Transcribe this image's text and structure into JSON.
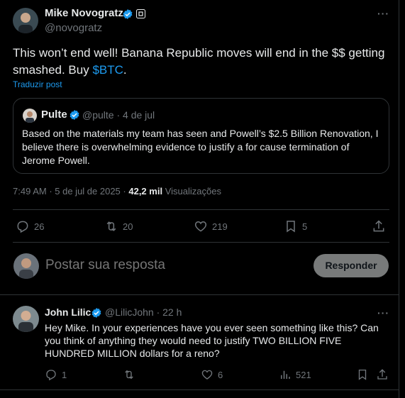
{
  "main_tweet": {
    "author_name": "Mike Novogratz",
    "author_handle": "@novogratz",
    "text_before": "This won’t end well!  Banana  Republic moves will end in the $$ getting smashed.  Buy ",
    "cashtag": "$BTC",
    "text_after": ".",
    "translate_label": "Traduzir post",
    "time": "7:49 AM",
    "date": "5 de jul de 2025",
    "views_count": "42,2 mil",
    "views_label": "Visualizações",
    "stats": {
      "replies": "26",
      "reposts": "20",
      "likes": "219",
      "bookmarks": "5"
    }
  },
  "quoted_tweet": {
    "author_name": "Pulte",
    "meta": "@pulte · 4 de jul",
    "text": "Based on the materials my team has seen and Powell’s $2.5 Billion Renovation, I believe there is overwhelming evidence to justify a for cause termination of Jerome Powell."
  },
  "reply_box": {
    "placeholder": "Postar sua resposta",
    "button_label": "Responder"
  },
  "comment": {
    "author_name": "John Lilic",
    "meta": "@LilicJohn · 22 h",
    "text": "Hey Mike. In your experiences have you ever seen something like this? Can you think of anything they would need to justify TWO BILLION FIVE HUNDRED MILLION dollars for a reno?",
    "stats": {
      "replies": "1",
      "likes": "6",
      "views": "521"
    }
  },
  "colors": {
    "accent": "#1d9bf0",
    "muted": "#71767b",
    "text": "#e7e9ea",
    "border": "#2f3336"
  }
}
